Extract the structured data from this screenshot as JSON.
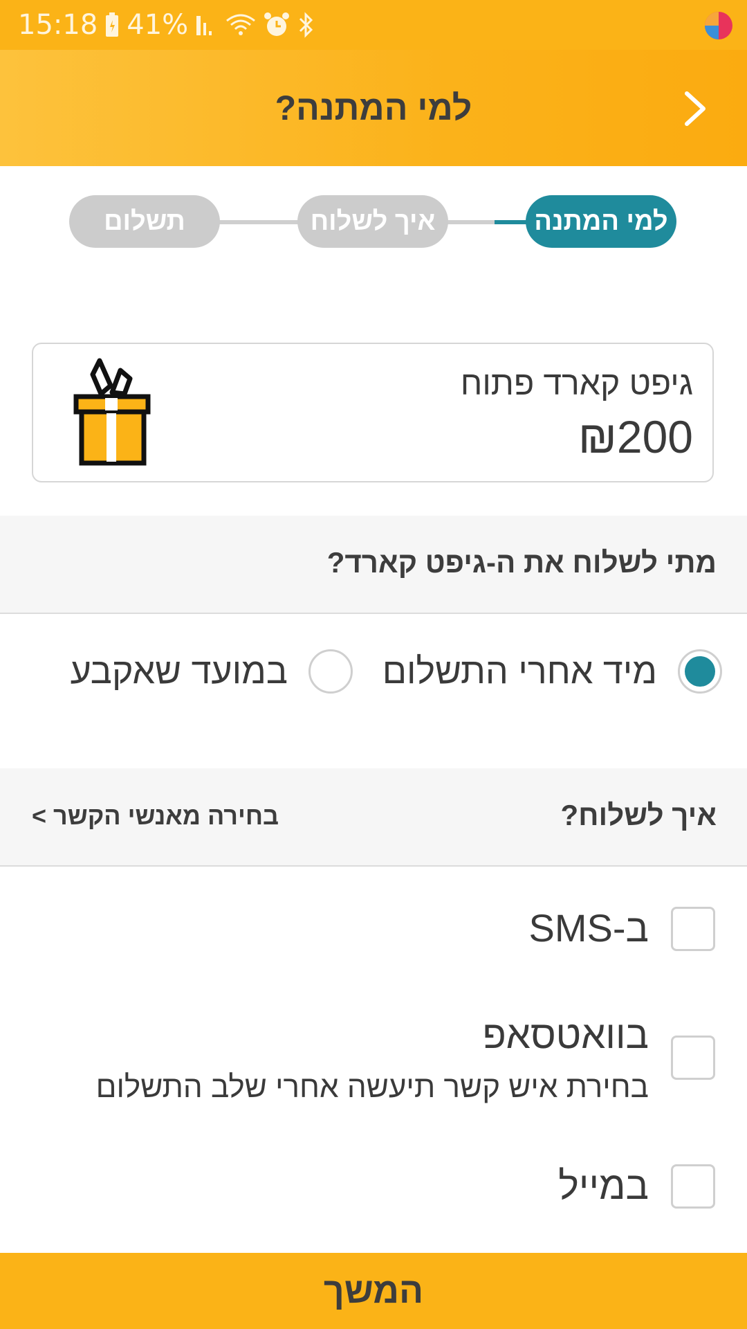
{
  "status_bar": {
    "time": "15:18",
    "battery": "41%",
    "icons": [
      "battery-icon",
      "signal-icon",
      "wifi-icon",
      "alarm-icon",
      "bluetooth-icon",
      "app-logo-icon"
    ]
  },
  "header": {
    "title": "למי המתנה?",
    "back_icon": "chevron-right-icon"
  },
  "stepper": {
    "steps": [
      {
        "label": "למי המתנה",
        "active": true
      },
      {
        "label": "איך לשלוח",
        "active": false
      },
      {
        "label": "תשלום",
        "active": false
      }
    ]
  },
  "gift": {
    "name": "גיפט קארד פתוח",
    "amount": "₪200",
    "icon": "gift-box-icon"
  },
  "when_section": {
    "title": "מתי לשלוח את ה-גיפט קארד?",
    "options": [
      {
        "label": "מיד אחרי התשלום",
        "selected": true
      },
      {
        "label": "במועד שאקבע",
        "selected": false
      }
    ]
  },
  "how_section": {
    "title": "איך לשלוח?",
    "contacts_link": "בחירה מאנשי הקשר >",
    "options": [
      {
        "label": "ב-SMS",
        "checked": false
      },
      {
        "label": "בוואטסאפ",
        "sublabel": "בחירת איש קשר תיעשה אחרי שלב התשלום",
        "checked": false
      },
      {
        "label": "במייל",
        "checked": false
      }
    ]
  },
  "footer": {
    "continue_label": "המשך"
  },
  "colors": {
    "brand_yellow": "#fbb317",
    "accent_teal": "#1f8b9c",
    "inactive_grey": "#cccccc"
  }
}
